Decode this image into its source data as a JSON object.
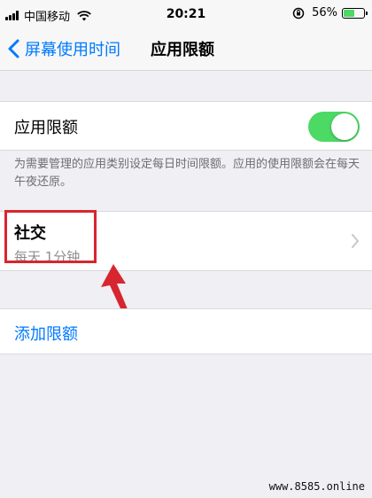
{
  "status_bar": {
    "carrier": "中国移动",
    "time": "20:21",
    "battery_text": "56%",
    "battery_level": 0.56,
    "battery_color": "#4cd964"
  },
  "nav": {
    "back_label": "屏幕使用时间",
    "title": "应用限额"
  },
  "limit_toggle": {
    "label": "应用限额",
    "on": true,
    "on_color": "#4cd964"
  },
  "description": "为需要管理的应用类别设定每日时间限额。应用的使用限额会在每天午夜还原。",
  "category": {
    "title": "社交",
    "subtitle": "每天 1分钟"
  },
  "add_limit_label": "添加限额",
  "annotation_color": "#d7262f",
  "watermark": "www.8585.online",
  "accent_color": "#007aff"
}
